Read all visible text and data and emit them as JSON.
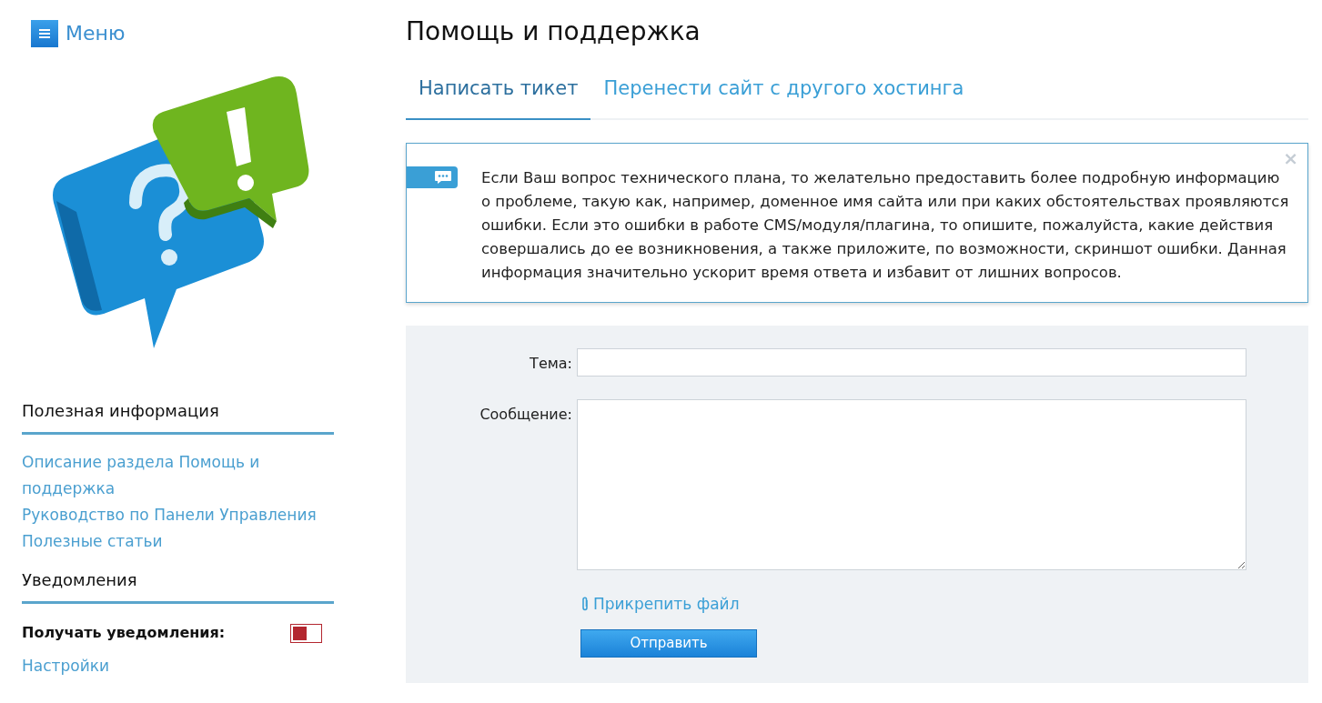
{
  "menu": {
    "label": "Меню"
  },
  "sidebar": {
    "sections": [
      {
        "title": "Полезная информация",
        "links": [
          "Описание раздела Помощь и поддержка",
          "Руководство по Панели Управления",
          "Полезные статьи"
        ]
      },
      {
        "title": "Уведомления",
        "toggle": {
          "label": "Получать уведомления:",
          "on": false
        },
        "links": [
          "Настройки"
        ]
      }
    ]
  },
  "page_title": "Помощь и поддержка",
  "tabs": [
    {
      "label": "Написать тикет",
      "selected": true
    },
    {
      "label": "Перенести сайт с другого хостинга",
      "selected": false
    }
  ],
  "notice": {
    "text": "Если Ваш вопрос технического плана, то желательно предоставить более подробную информацию о проблеме, такую как, например, доменное имя сайта или при каких обстоятельствах проявляются ошибки. Если это ошибки в работе CMS/модуля/плагина, то опишите, пожалуйста, какие действия совершались до ее возникновения, а также приложите, по возможности, скриншот ошибки. Данная информация значительно ускорит время ответа и избавит от лишних вопросов.",
    "close": "×"
  },
  "form": {
    "fields": [
      {
        "kind": "input",
        "label": "Тема:"
      },
      {
        "kind": "textarea",
        "label": "Сообщение:"
      }
    ],
    "attach": "Прикрепить файл",
    "submit": "Отправить"
  }
}
